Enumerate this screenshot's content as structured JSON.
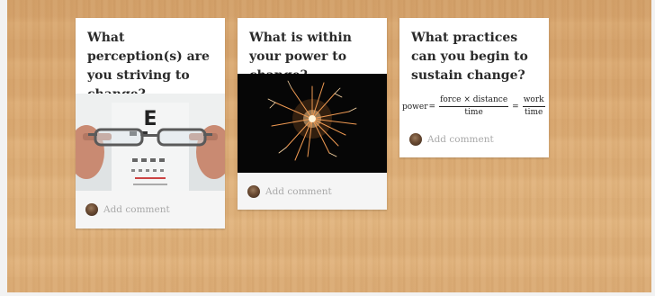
{
  "cards": [
    {
      "title": "What perception(s) are you striving to change?",
      "image_icon": "eyeglasses-eye-chart-photo",
      "eye_chart_letter": "E",
      "comment_placeholder": "Add comment"
    },
    {
      "title": "What is within your power to change?",
      "image_icon": "sparkler-photo",
      "comment_placeholder": "Add comment"
    },
    {
      "title": "What practices can you begin to sustain change?",
      "formula": {
        "lhs": "power",
        "equals": "=",
        "frac1_num": "force × distance",
        "frac1_den": "time",
        "frac2_num": "work",
        "frac2_den": "time"
      },
      "comment_placeholder": "Add comment"
    }
  ],
  "colors": {
    "board": "#dcab74",
    "card": "#ffffff",
    "footer": "#f5f5f5",
    "placeholder_text": "#a9a9a9"
  }
}
